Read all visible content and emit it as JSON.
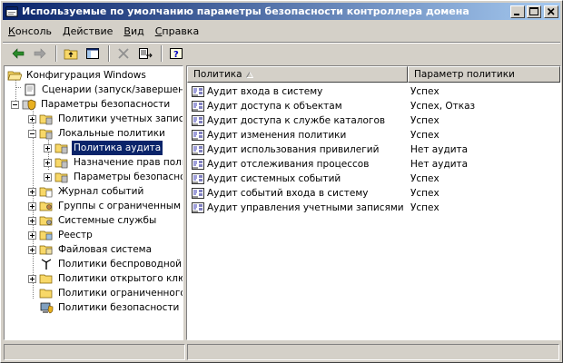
{
  "window": {
    "title": "Используемые по умолчанию параметры безопасности контроллера домена"
  },
  "menu": [
    {
      "pre": "",
      "u": "К",
      "post": "онсоль"
    },
    {
      "pre": "",
      "u": "Д",
      "post": "ействие"
    },
    {
      "pre": "",
      "u": "В",
      "post": "ид"
    },
    {
      "pre": "",
      "u": "С",
      "post": "правка"
    }
  ],
  "tree": {
    "root": "Конфигурация Windows",
    "scripts": "Сценарии (запуск/завершение)",
    "security": "Параметры безопасности",
    "account_policies": "Политики учетных записей",
    "local_policies": "Локальные политики",
    "audit_policy": "Политика аудита",
    "user_rights": "Назначение прав пользо",
    "security_options": "Параметры безопаснос",
    "event_log": "Журнал событий",
    "restricted_groups": "Группы с ограниченным дос",
    "system_services": "Системные службы",
    "registry": "Реестр",
    "file_system": "Файловая система",
    "wireless": "Политики беспроводной сет",
    "public_key": "Политики открытого ключа",
    "software_restriction": "Политики ограниченного ис",
    "ip_security": "Политики безопасности IP н"
  },
  "list": {
    "col_policy": "Политика",
    "col_setting": "Параметр политики",
    "rows": [
      {
        "policy": "Аудит входа в систему",
        "setting": "Успех"
      },
      {
        "policy": "Аудит доступа к объектам",
        "setting": "Успех, Отказ"
      },
      {
        "policy": "Аудит доступа к службе каталогов",
        "setting": "Успех"
      },
      {
        "policy": "Аудит изменения политики",
        "setting": "Успех"
      },
      {
        "policy": "Аудит использования привилегий",
        "setting": "Нет аудита"
      },
      {
        "policy": "Аудит отслеживания процессов",
        "setting": "Нет аудита"
      },
      {
        "policy": "Аудит системных событий",
        "setting": "Успех"
      },
      {
        "policy": "Аудит событий входа в систему",
        "setting": "Успех"
      },
      {
        "policy": "Аудит управления учетными записями",
        "setting": "Успех"
      }
    ]
  },
  "colors": {
    "title_start": "#0a246a",
    "title_end": "#a6caf0",
    "face": "#d4d0c8",
    "selection": "#0a246a"
  }
}
